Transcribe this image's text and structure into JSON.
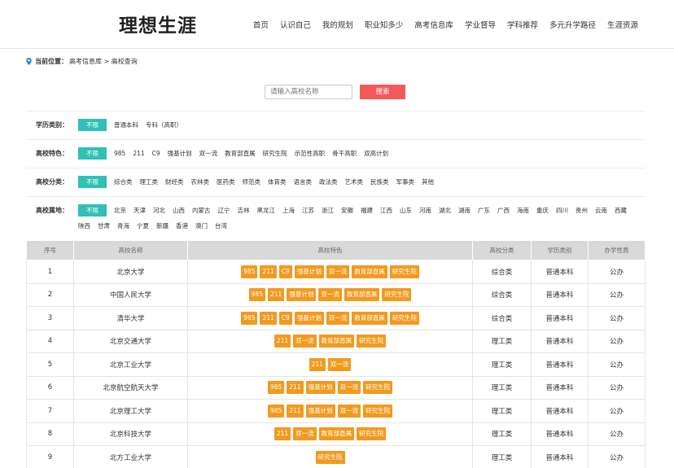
{
  "header": {
    "logo": "理想生涯",
    "nav": [
      "首页",
      "认识自己",
      "我的规划",
      "职业知多少",
      "高考信息库",
      "学业督导",
      "学科推荐",
      "多元升学路径",
      "生涯资源"
    ]
  },
  "breadcrumb": {
    "prefix": "当前位置：",
    "path": "高考信息库 > 高校查询"
  },
  "search": {
    "placeholder": "请输入高校名称",
    "button": "搜索"
  },
  "filters": [
    {
      "label": "学历类别：",
      "options": [
        "不限",
        "普通本科",
        "专科（高职）"
      ]
    },
    {
      "label": "高校特色：",
      "options": [
        "不限",
        "985",
        "211",
        "C9",
        "强基计划",
        "双一流",
        "教育部直属",
        "研究生院",
        "示范性高职",
        "骨干高职",
        "双高计划"
      ]
    },
    {
      "label": "高校分类：",
      "options": [
        "不限",
        "综合类",
        "理工类",
        "财经类",
        "农林类",
        "医药类",
        "师范类",
        "体育类",
        "语言类",
        "政法类",
        "艺术类",
        "民族类",
        "军事类",
        "其他"
      ]
    },
    {
      "label": "高校属地：",
      "options": [
        "不限",
        "北京",
        "天津",
        "河北",
        "山西",
        "内蒙古",
        "辽宁",
        "吉林",
        "黑龙江",
        "上海",
        "江苏",
        "浙江",
        "安徽",
        "福建",
        "江西",
        "山东",
        "河南",
        "湖北",
        "湖南",
        "广东",
        "广西",
        "海南",
        "重庆",
        "四川",
        "贵州",
        "云南",
        "西藏",
        "陕西",
        "甘肃",
        "青海",
        "宁夏",
        "新疆",
        "香港",
        "澳门",
        "台湾"
      ]
    }
  ],
  "table": {
    "headers": [
      "序号",
      "高校名称",
      "高校特色",
      "高校分类",
      "学历类别",
      "办学性质"
    ],
    "rows": [
      {
        "no": "1",
        "name": "北京大学",
        "tags": [
          "985",
          "211",
          "C9",
          "强基计划",
          "双一流",
          "教育部直属",
          "研究生院"
        ],
        "type": "综合类",
        "level": "普通本科",
        "nature": "公办"
      },
      {
        "no": "2",
        "name": "中国人民大学",
        "tags": [
          "985",
          "211",
          "强基计划",
          "双一流",
          "教育部直属",
          "研究生院"
        ],
        "type": "综合类",
        "level": "普通本科",
        "nature": "公办"
      },
      {
        "no": "3",
        "name": "清华大学",
        "tags": [
          "985",
          "211",
          "C9",
          "强基计划",
          "双一流",
          "教育部直属",
          "研究生院"
        ],
        "type": "综合类",
        "level": "普通本科",
        "nature": "公办"
      },
      {
        "no": "4",
        "name": "北京交通大学",
        "tags": [
          "211",
          "双一流",
          "教育部直属",
          "研究生院"
        ],
        "type": "理工类",
        "level": "普通本科",
        "nature": "公办"
      },
      {
        "no": "5",
        "name": "北京工业大学",
        "tags": [
          "211",
          "双一流"
        ],
        "type": "理工类",
        "level": "普通本科",
        "nature": "公办"
      },
      {
        "no": "6",
        "name": "北京航空航天大学",
        "tags": [
          "985",
          "211",
          "强基计划",
          "双一流",
          "研究生院"
        ],
        "type": "理工类",
        "level": "普通本科",
        "nature": "公办"
      },
      {
        "no": "7",
        "name": "北京理工大学",
        "tags": [
          "985",
          "211",
          "强基计划",
          "双一流",
          "研究生院"
        ],
        "type": "理工类",
        "level": "普通本科",
        "nature": "公办"
      },
      {
        "no": "8",
        "name": "北京科技大学",
        "tags": [
          "211",
          "双一流",
          "教育部直属",
          "研究生院"
        ],
        "type": "理工类",
        "level": "普通本科",
        "nature": "公办"
      },
      {
        "no": "9",
        "name": "北方工业大学",
        "tags": [
          "研究生院"
        ],
        "type": "理工类",
        "level": "普通本科",
        "nature": "公办"
      }
    ]
  }
}
